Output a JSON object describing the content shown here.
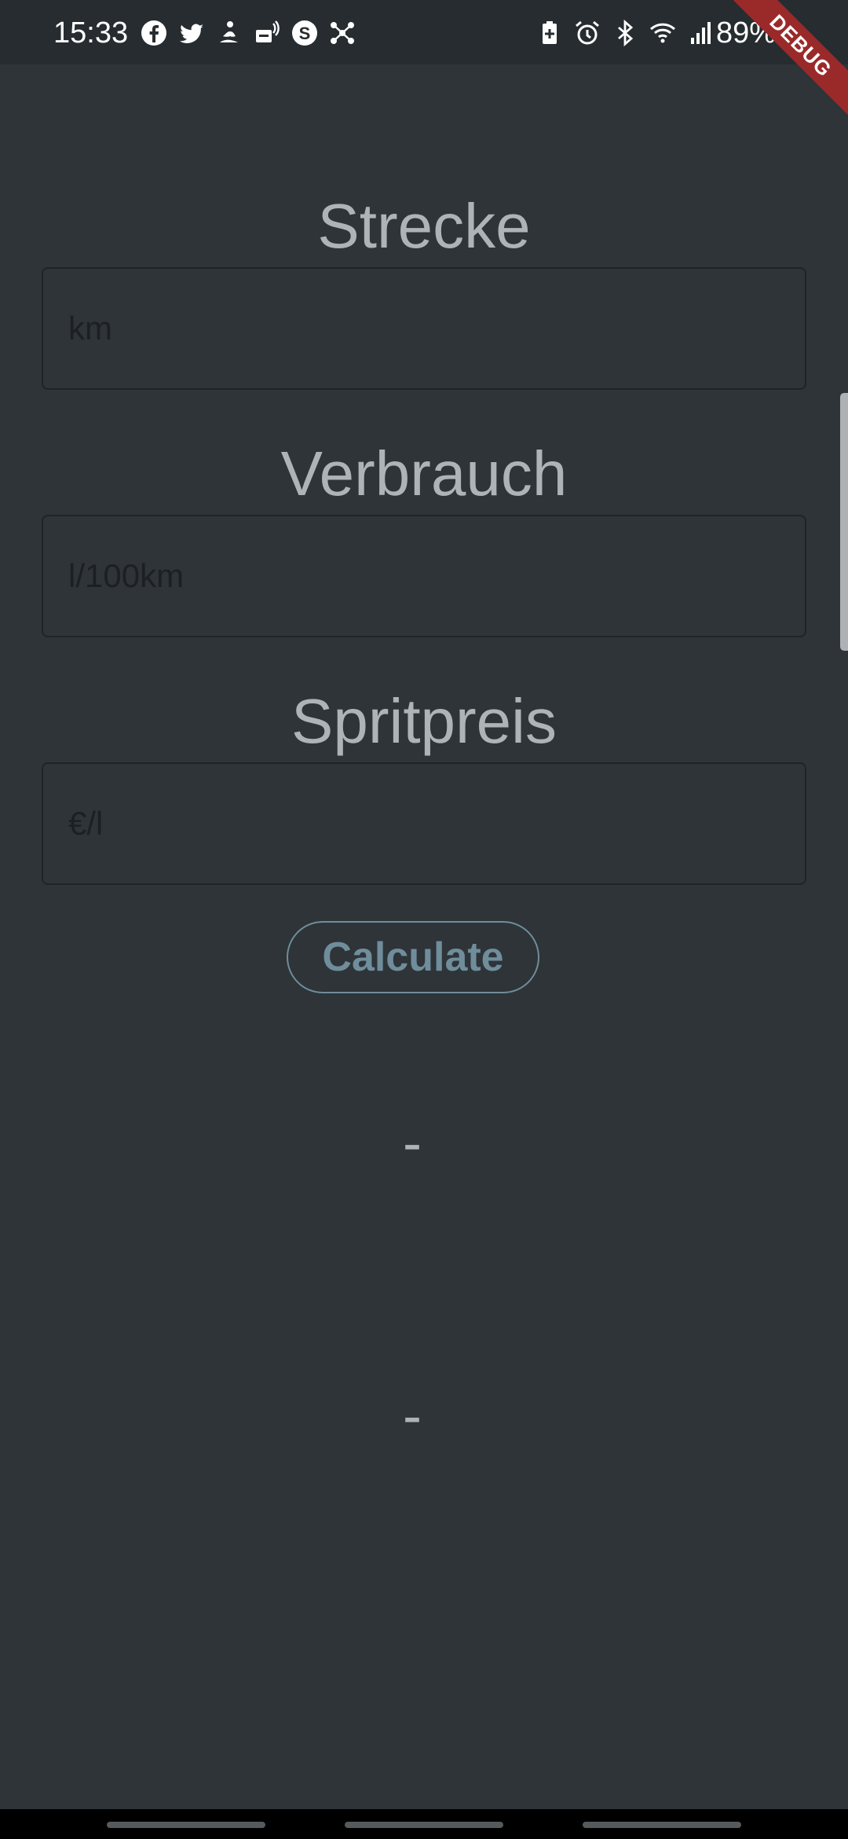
{
  "status_bar": {
    "time": "15:33",
    "battery_percent": "89%",
    "notification_icons": [
      "facebook-icon",
      "twitter-icon",
      "meditation-icon",
      "nfc-icon",
      "s-app-icon",
      "network-icon"
    ],
    "system_icons": [
      "battery-saver-icon",
      "alarm-icon",
      "bluetooth-icon",
      "wifi-icon",
      "signal-icon"
    ],
    "debug_banner": "DEBUG"
  },
  "form": {
    "distance": {
      "label": "Strecke",
      "placeholder": "km",
      "value": ""
    },
    "consumption": {
      "label": "Verbrauch",
      "placeholder": "l/100km",
      "value": ""
    },
    "fuel_price": {
      "label": "Spritpreis",
      "placeholder": "€/l",
      "value": ""
    },
    "calculate_label": "Calculate"
  },
  "results": {
    "primary": "-",
    "secondary": "-"
  },
  "colors": {
    "background": "#2e3438",
    "label_text": "#adb3b6",
    "accent": "#6f8d9b",
    "debug_ribbon": "#9a2a2a"
  }
}
